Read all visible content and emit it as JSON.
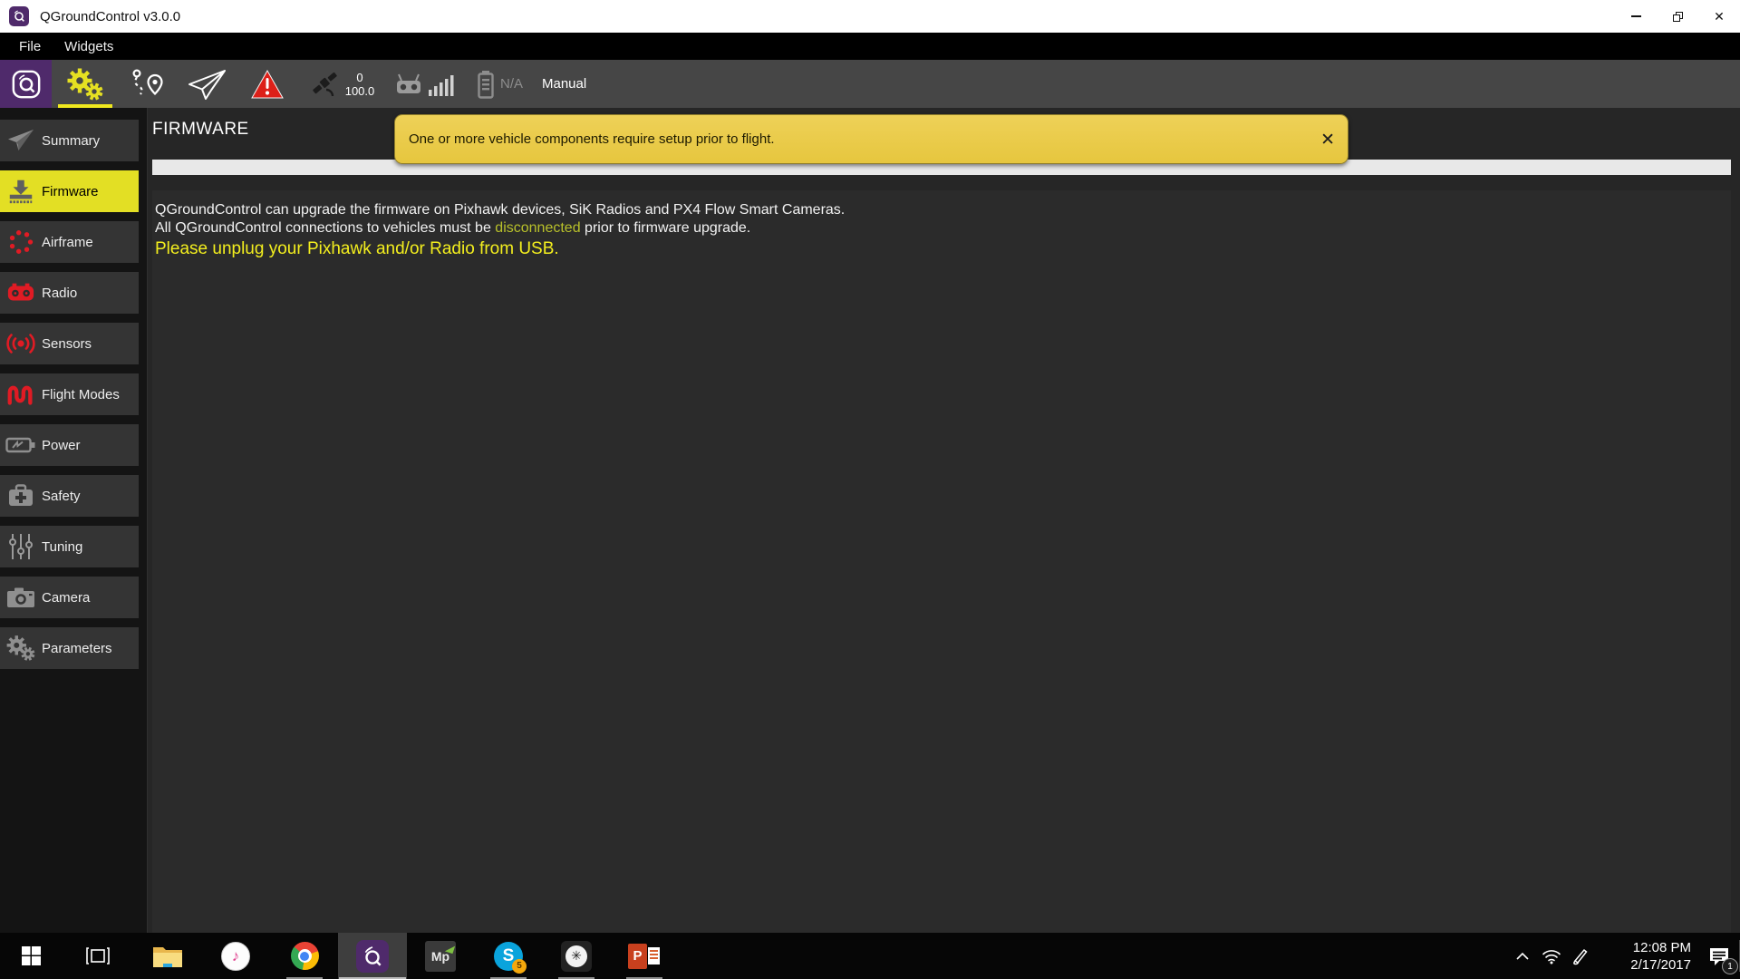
{
  "window": {
    "title": "QGroundControl v3.0.0",
    "close_glyph": "✕"
  },
  "menu": {
    "file": "File",
    "widgets": "Widgets"
  },
  "toolbar": {
    "gps_count": "0",
    "gps_hdop": "100.0",
    "battery_status": "N/A",
    "flight_mode": "Manual"
  },
  "sidebar": {
    "items": [
      {
        "label": "Summary"
      },
      {
        "label": "Firmware"
      },
      {
        "label": "Airframe"
      },
      {
        "label": "Radio"
      },
      {
        "label": "Sensors"
      },
      {
        "label": "Flight Modes"
      },
      {
        "label": "Power"
      },
      {
        "label": "Safety"
      },
      {
        "label": "Tuning"
      },
      {
        "label": "Camera"
      },
      {
        "label": "Parameters"
      }
    ],
    "selected": "Firmware"
  },
  "main": {
    "title": "FIRMWARE",
    "banner": {
      "text": "One or more vehicle components require setup prior to flight.",
      "close_glyph": "✕"
    },
    "progress_percent": 0,
    "info": {
      "line1": "QGroundControl can upgrade the firmware on Pixhawk devices, SiK Radios and PX4 Flow Smart Cameras.",
      "line2_prefix": "All QGroundControl connections to vehicles must be ",
      "line2_link": "disconnected",
      "line2_suffix": " prior to firmware upgrade.",
      "line3": "Please unplug your Pixhawk and/or Radio from USB."
    }
  },
  "taskbar": {
    "icons": [
      "start",
      "task-view",
      "file-explorer",
      "itunes",
      "chrome",
      "qgroundcontrol",
      "mission-planner",
      "skype",
      "asterisk-app",
      "powerpoint"
    ],
    "itunes_glyph": "♪",
    "mp_label": "Mp",
    "skype_letter": "S",
    "skype_badge": "5",
    "asterisk_glyph": "✳",
    "ppt_letter": "P",
    "tray": {
      "time": "12:08 PM",
      "date": "2/17/2017",
      "notification_count": "1"
    }
  },
  "colors": {
    "accent_yellow": "#e5e022",
    "selected_yellow": "#e3df24",
    "banner_yellow": "#e9ca45",
    "alert_red": "#e01b24",
    "qgc_purple": "#4f2a6b",
    "link_green": "#b8c02a",
    "warn_text_yellow": "#f3ee1e"
  }
}
